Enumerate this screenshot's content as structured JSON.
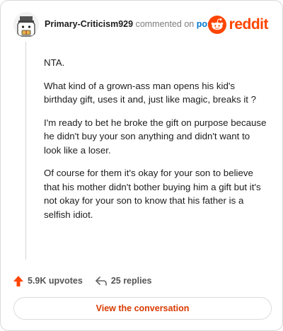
{
  "comment": {
    "author": "Primary-Criticism929",
    "action_text": "commented on",
    "post_link": "post",
    "brand": "reddit",
    "paragraphs": [
      "NTA.",
      "What kind of a grown-ass man opens his kid's birthday gift, uses it and, just like magic, breaks it ?",
      "I'm ready to bet he broke the gift on purpose because he didn't buy your son anything and didn't want to look like a loser.",
      "Of course for them it's okay for your son to believe that his mother didn't bother buying him a gift but it's not okay for your son to know that his father is a selfish idiot."
    ],
    "upvotes": "5.9K upvotes",
    "replies": "25 replies",
    "view_button": "View the conversation"
  },
  "colors": {
    "brand": "#ff4500",
    "link": "#0079d3",
    "button_text": "#d93a00"
  },
  "icons": [
    "avatar-image",
    "reddit-snoo-icon",
    "upvote-arrow-icon",
    "reply-arrow-icon"
  ]
}
